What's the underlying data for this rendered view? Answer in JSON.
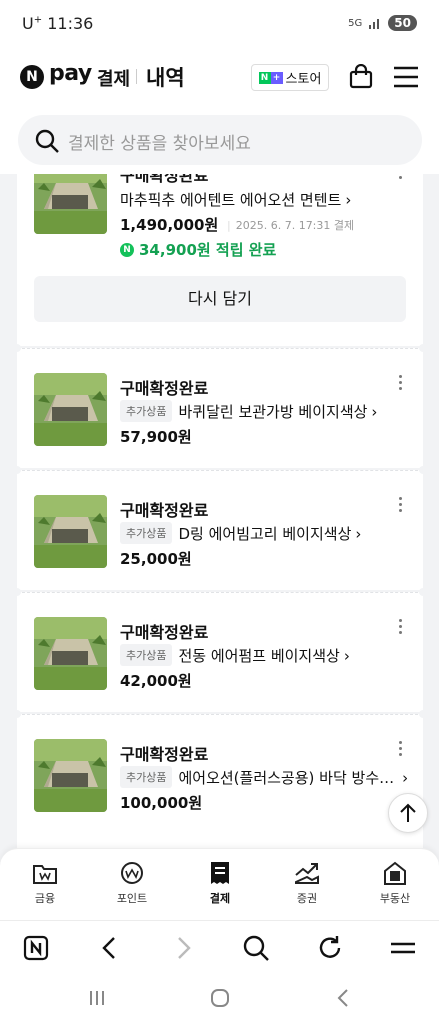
{
  "status_bar": {
    "carrier": "U",
    "carrier_sup": "+",
    "time": "11:36",
    "network": "5G",
    "battery": "50"
  },
  "header": {
    "logo_mark": "N",
    "logo_pay": "pay",
    "logo_sub": "결제",
    "title": "내역",
    "store_label": "스토어",
    "store_badge": [
      "N",
      "+"
    ]
  },
  "search": {
    "placeholder": "결제한 상품을 찾아보세요"
  },
  "orders": [
    {
      "status": "구매확정완료",
      "name": "마추픽추 에어텐트 에어오션 면텐트",
      "price": "1,490,000원",
      "date": "2025. 6. 7. 17:31 결제",
      "point": "34,900원 적립 완료",
      "point_icon": "naver-pay-point-icon",
      "action": "다시 담기"
    },
    {
      "status": "구매확정완료",
      "tag": "추가상품",
      "name": "바퀴달린 보관가방 베이지색상",
      "price": "57,900원"
    },
    {
      "status": "구매확정완료",
      "tag": "추가상품",
      "name": "D링 에어빔고리 베이지색상",
      "price": "25,000원"
    },
    {
      "status": "구매확정완료",
      "tag": "추가상품",
      "name": "전동 에어펌프 베이지색상",
      "price": "42,000원"
    },
    {
      "status": "구매확정완료",
      "tag": "추가상품",
      "name": "에어오션(플러스공용) 바닥 방수…",
      "price": "100,000원"
    }
  ],
  "bottom_nav": [
    {
      "label": "금융",
      "icon": "wallet-icon"
    },
    {
      "label": "포인트",
      "icon": "point-coin-icon"
    },
    {
      "label": "결제",
      "icon": "receipt-icon",
      "active": true
    },
    {
      "label": "증권",
      "icon": "stock-chart-icon"
    },
    {
      "label": "부동산",
      "icon": "building-icon"
    }
  ],
  "browser_bar": [
    "naver-home-icon",
    "back-icon",
    "forward-icon",
    "search-icon",
    "refresh-icon",
    "menu-icon"
  ],
  "colors": {
    "point_green": "#14a152",
    "background": "#f2f3f5",
    "text": "#111111"
  }
}
